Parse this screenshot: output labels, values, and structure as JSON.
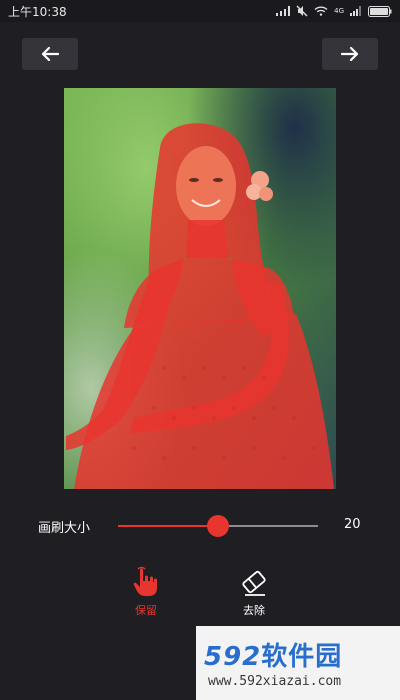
{
  "status_bar": {
    "time": "上午10:38",
    "network_label": "4G"
  },
  "toolbar": {
    "back_icon": "arrow-left-icon",
    "forward_icon": "arrow-right-icon"
  },
  "editor": {
    "overlay_color": "#e8352f"
  },
  "brush": {
    "label": "画刷大小",
    "value": "20",
    "level": 0.5
  },
  "tools": [
    {
      "label": "保留",
      "icon": "hand-pointer-icon",
      "active": true
    },
    {
      "label": "去除",
      "icon": "eraser-icon",
      "active": false
    }
  ],
  "watermark": {
    "logo_digits": "592",
    "logo_text": "软件园",
    "url": "www.592xiazai.com"
  }
}
